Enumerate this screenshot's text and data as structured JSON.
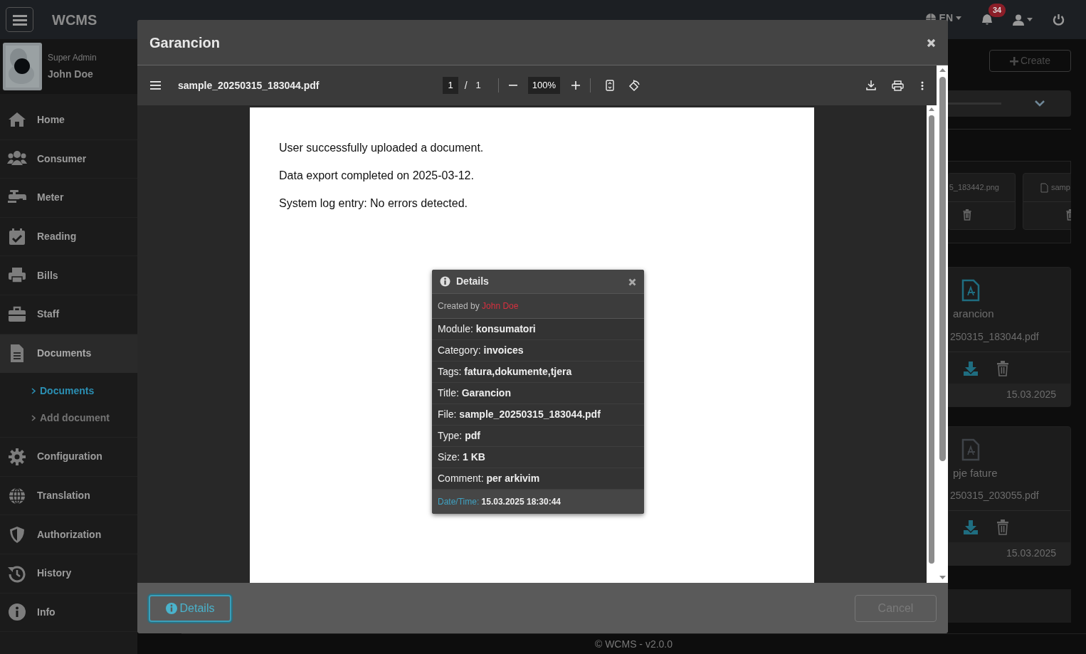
{
  "navbar": {
    "brand": "WCMS",
    "language": "EN",
    "notifications_badge": "34"
  },
  "profile": {
    "role": "Super Admin",
    "name": "John Doe"
  },
  "sidebar": {
    "items": [
      {
        "label": "Home",
        "selected": false
      },
      {
        "label": "Consumer",
        "selected": false
      },
      {
        "label": "Meter",
        "selected": false
      },
      {
        "label": "Reading",
        "selected": false
      },
      {
        "label": "Bills",
        "selected": false
      },
      {
        "label": "Staff",
        "selected": false
      },
      {
        "label": "Documents",
        "selected": true,
        "expanded": true,
        "children": [
          {
            "label": "Documents",
            "selected": true
          },
          {
            "label": "Add document",
            "selected": false
          }
        ]
      },
      {
        "label": "Configuration",
        "selected": false
      },
      {
        "label": "Translation",
        "selected": false
      },
      {
        "label": "Authorization",
        "selected": false
      },
      {
        "label": "History",
        "selected": false
      },
      {
        "label": "Info",
        "selected": false
      }
    ]
  },
  "content": {
    "create_button": "Create",
    "files": [
      {
        "name": "5_183442.png"
      },
      {
        "name": "samp"
      }
    ],
    "documents": [
      {
        "title": "arancion",
        "file": "250315_183044.pdf",
        "date": "15.03.2025",
        "highlighted": true
      },
      {
        "title": "pje fature",
        "file": "250315_203055.pdf",
        "date": "15.03.2025",
        "highlighted": false
      }
    ]
  },
  "footer": "© WCMS - v2.0.0",
  "modal": {
    "title": "Garancion",
    "viewer": {
      "file_name": "sample_20250315_183044.pdf",
      "page": "1",
      "page_count": "1",
      "separator": "/",
      "zoom": "100%",
      "lines": [
        "User successfully uploaded a document.",
        "Data export completed on 2025-03-12.",
        "System log entry: No errors detected."
      ]
    },
    "details_popover": {
      "title": "Details",
      "created_by_label": "Created by",
      "created_by": "John Doe",
      "fields": [
        {
          "label": "Module:",
          "value": "konsumatori"
        },
        {
          "label": "Category:",
          "value": "invoices"
        },
        {
          "label": "Tags:",
          "value": "fatura,dokumente,tjera"
        },
        {
          "label": "Title:",
          "value": "Garancion"
        },
        {
          "label": "File:",
          "value": "sample_20250315_183044.pdf"
        },
        {
          "label": "Type:",
          "value": "pdf"
        },
        {
          "label": "Size:",
          "value": "1 KB"
        },
        {
          "label": "Comment:",
          "value": "per arkivim"
        }
      ],
      "datetime_label": "Date/Time:",
      "datetime": "15.03.2025 18:30:44"
    },
    "buttons": [
      {
        "label": "Details",
        "kind": "info",
        "focused": true,
        "disabled": false
      },
      {
        "label": "Cancel",
        "kind": "cancel",
        "focused": false,
        "disabled": true
      }
    ]
  }
}
